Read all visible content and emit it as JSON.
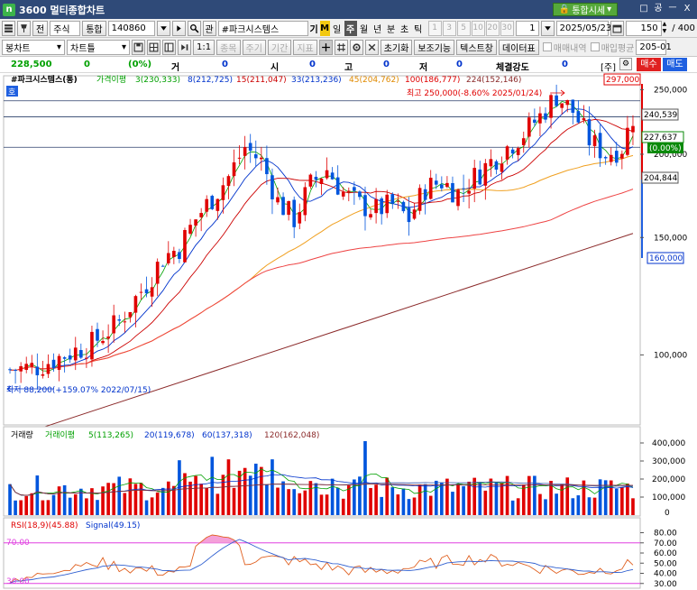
{
  "window": {
    "app_icon": "n",
    "title": "3600 멀티종합차트",
    "sise_label": "통합시세",
    "win_controls": [
      "□",
      "공",
      "ㅡ",
      "X"
    ]
  },
  "toolbar1": {
    "jeon": "전",
    "market": "주식",
    "search": "통합",
    "code": "140860",
    "search_icon": "search-icon",
    "pan": "관",
    "name": "#파크시스템스",
    "ki": "기",
    "m": "M",
    "periods": [
      "일",
      "주",
      "월",
      "년",
      "분",
      "초",
      "틱"
    ],
    "active_period": "주",
    "minute_steps": [
      "1",
      "3",
      "5",
      "10",
      "20",
      "30"
    ],
    "step_value": "1",
    "date": "2025/05/23",
    "count": "150",
    "total": "/ 400"
  },
  "toolbar2": {
    "bongchart": "봉차트",
    "chartteul": "차트틀",
    "one_one": "1:1",
    "jongmok": "종목",
    "jugi": "주기",
    "gigan": "기간",
    "jipyo": "지표",
    "choki": "초기화",
    "bojo": "보조기능",
    "text_window": "텍스트창",
    "data_table": "데이터표",
    "trade_history": "매매내역",
    "avg_price": "매입평균",
    "trail": "205-01"
  },
  "info": {
    "price": "228,500",
    "change": "0",
    "rate": "(0%)",
    "open_label": "거",
    "open_value": "0",
    "si_label": "시",
    "si_value": "0",
    "go_label": "고",
    "go_value": "0",
    "jeo_label": "저",
    "jeo_value": "0",
    "strength_label": "체결강도",
    "strength_value": "0",
    "ju_label": "[주]",
    "buy_label": "매수",
    "sell_label": "매도"
  },
  "price_panel": {
    "title": "#파크시스템스(통)",
    "ma_label": "가격이평",
    "ma_items": [
      {
        "text": "3(230,333)",
        "color": "#00a000"
      },
      {
        "text": "8(212,725)",
        "color": "#0033cc"
      },
      {
        "text": "15(211,047)",
        "color": "#cc0000"
      },
      {
        "text": "33(213,236)",
        "color": "#0033cc"
      },
      {
        "text": "45(204,762)",
        "color": "#e08a00"
      },
      {
        "text": "100(186,777)",
        "color": "#e00000"
      },
      {
        "text": "224(152,146)",
        "color": "#8b2a2a"
      }
    ],
    "high_label": "최고 250,000(-8.60% 2025/01/24)",
    "low_label": "최저 88,200(+159.07% 2022/07/15)",
    "ho_label": "호",
    "axis_ticks": [
      {
        "label": "250,000",
        "value": 250000
      },
      {
        "label": "200,000",
        "value": 200000
      },
      {
        "label": "150,000",
        "value": 150000
      },
      {
        "label": "100,000",
        "value": 100000
      }
    ],
    "tags": {
      "top": "297,000",
      "bottom": "160,000",
      "l240": "240,539",
      "current": "227,637",
      "current_rate": "(0.00%)",
      "l204": "204,844"
    }
  },
  "volume_panel": {
    "title": "거래량",
    "ma_label": "거래이평",
    "ma_items": [
      {
        "text": "5(113,265)",
        "color": "#00a000"
      },
      {
        "text": "20(119,678)",
        "color": "#0033cc"
      },
      {
        "text": "60(137,318)",
        "color": "#0033cc"
      },
      {
        "text": "120(162,048)",
        "color": "#8b2a2a"
      }
    ],
    "axis_ticks": [
      {
        "label": "400,000",
        "value": 400000
      },
      {
        "label": "300,000",
        "value": 300000
      },
      {
        "label": "200,000",
        "value": 200000
      },
      {
        "label": "100,000",
        "value": 100000
      }
    ],
    "bottom_label": "0"
  },
  "rsi_panel": {
    "title": "RSI(18,9)(45.88)",
    "signal": "Signal(49.15)",
    "upper_label": "70.00",
    "lower_label": "30.00",
    "axis_ticks": [
      {
        "label": "80.00",
        "value": 80
      },
      {
        "label": "70.00",
        "value": 70
      },
      {
        "label": "60.00",
        "value": 60
      },
      {
        "label": "50.00",
        "value": 50
      },
      {
        "label": "40.00",
        "value": 40
      },
      {
        "label": "30.00",
        "value": 30
      }
    ]
  },
  "colors": {
    "up": "#e00000",
    "down": "#0055dd",
    "ma3": "#00a000",
    "ma8": "#0033cc",
    "ma15": "#cc0000",
    "ma45": "#f0a020",
    "ma100": "#ee4444",
    "ma224": "#8b2a2a"
  },
  "chart_data": {
    "type": "candlestick",
    "anchor_series": [
      {
        "name": "close",
        "points": [
          [
            0,
            95000
          ],
          [
            5,
            96000
          ],
          [
            10,
            100000
          ],
          [
            15,
            104000
          ],
          [
            20,
            112000
          ],
          [
            25,
            128000
          ],
          [
            28,
            140000
          ],
          [
            31,
            145000
          ],
          [
            34,
            160000
          ],
          [
            37,
            172000
          ],
          [
            40,
            185000
          ],
          [
            43,
            205000
          ],
          [
            46,
            195000
          ],
          [
            49,
            170000
          ],
          [
            52,
            160000
          ],
          [
            55,
            180000
          ],
          [
            58,
            190000
          ],
          [
            61,
            175000
          ],
          [
            64,
            168000
          ],
          [
            67,
            165000
          ],
          [
            70,
            168000
          ],
          [
            73,
            160000
          ],
          [
            76,
            178000
          ],
          [
            79,
            182000
          ],
          [
            82,
            175000
          ],
          [
            85,
            185000
          ],
          [
            88,
            195000
          ],
          [
            91,
            205000
          ],
          [
            94,
            215000
          ],
          [
            97,
            228000
          ],
          [
            100,
            245000
          ],
          [
            103,
            232000
          ],
          [
            106,
            210000
          ],
          [
            109,
            200000
          ],
          [
            112,
            205000
          ],
          [
            114,
            228000
          ]
        ]
      },
      {
        "name": "MA 224",
        "points": [
          [
            0,
            75000
          ],
          [
            114,
            152146
          ]
        ]
      }
    ],
    "price_range": [
      80000,
      255000
    ]
  }
}
